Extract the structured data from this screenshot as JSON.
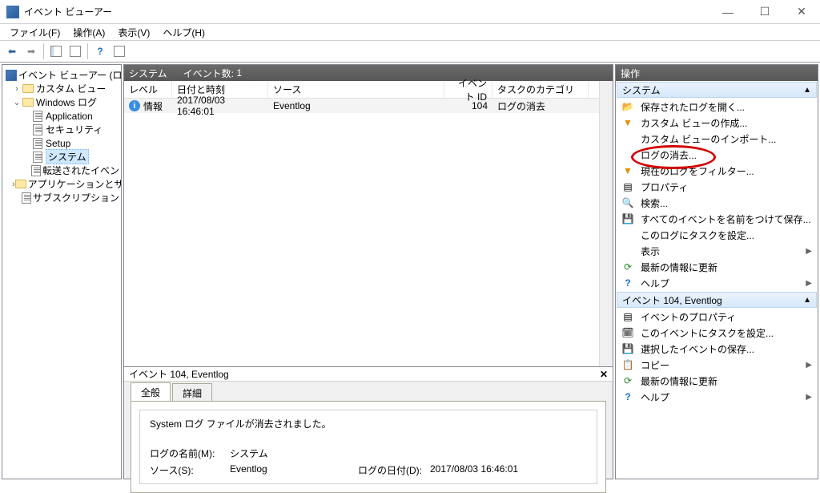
{
  "window": {
    "title": "イベント ビューアー",
    "controls": {
      "min": "—",
      "max": "☐",
      "close": "✕"
    }
  },
  "menu": {
    "file": "ファイル(F)",
    "action": "操作(A)",
    "view": "表示(V)",
    "help": "ヘルプ(H)"
  },
  "tree": {
    "root": "イベント ビューアー (ローカル)",
    "custom": "カスタム ビュー",
    "winlogs": "Windows ログ",
    "app": "Application",
    "sec": "セキュリティ",
    "setup": "Setup",
    "sys": "システム",
    "fwd": "転送されたイベント",
    "appsvc": "アプリケーションとサービス ログ",
    "subs": "サブスクリプション"
  },
  "list": {
    "header_name": "システム",
    "header_count_label": "イベント数:",
    "header_count": "1",
    "cols": {
      "level": "レベル",
      "datetime": "日付と時刻",
      "source": "ソース",
      "eventid": "イベント ID",
      "category": "タスクのカテゴリ"
    },
    "row": {
      "level": "情報",
      "datetime": "2017/08/03 16:46:01",
      "source": "Eventlog",
      "eventid": "104",
      "category": "ログの消去"
    }
  },
  "detail": {
    "title": "イベント 104, Eventlog",
    "close": "✕",
    "tabs": {
      "general": "全般",
      "details": "詳細"
    },
    "message": "System ログ ファイルが消去されました。",
    "logname_label": "ログの名前(M):",
    "logname_value": "システム",
    "source_label": "ソース(S):",
    "source_value": "Eventlog",
    "logged_label": "ログの日付(D):",
    "logged_value": "2017/08/03 16:46:01"
  },
  "actions": {
    "pane_title": "操作",
    "section1": "システム",
    "open_saved": "保存されたログを開く...",
    "create_view": "カスタム ビューの作成...",
    "import_view": "カスタム ビューのインポート...",
    "clear_log": "ログの消去...",
    "filter_log": "現在のログをフィルター...",
    "properties": "プロパティ",
    "find": "検索...",
    "save_all": "すべてのイベントを名前をつけて保存...",
    "attach_task": "このログにタスクを設定...",
    "view": "表示",
    "refresh": "最新の情報に更新",
    "help": "ヘルプ",
    "section2": "イベント 104, Eventlog",
    "event_props": "イベントのプロパティ",
    "attach_task_evt": "このイベントにタスクを設定...",
    "save_selected": "選択したイベントの保存...",
    "copy": "コピー",
    "refresh2": "最新の情報に更新",
    "help2": "ヘルプ"
  }
}
